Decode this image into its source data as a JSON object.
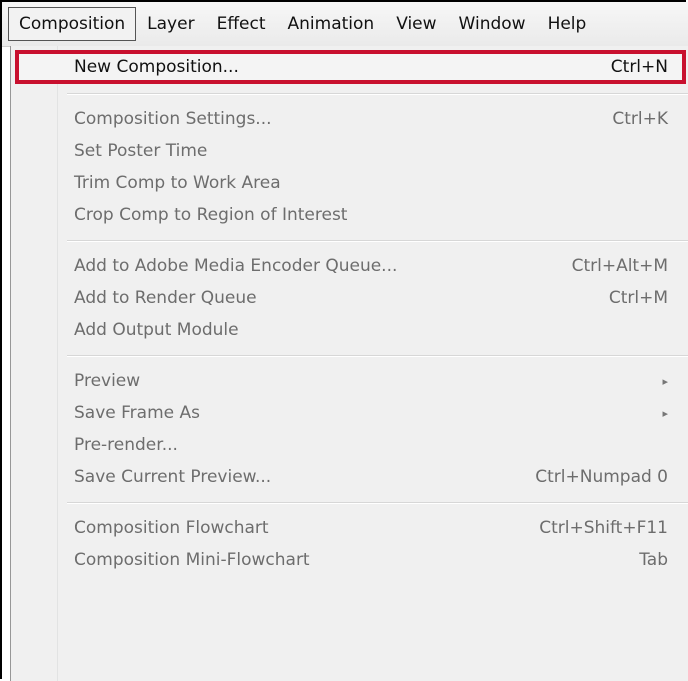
{
  "menubar": {
    "items": [
      {
        "label": "Composition"
      },
      {
        "label": "Layer"
      },
      {
        "label": "Effect"
      },
      {
        "label": "Animation"
      },
      {
        "label": "View"
      },
      {
        "label": "Window"
      },
      {
        "label": "Help"
      }
    ]
  },
  "menu": {
    "new_composition": {
      "label": "New Composition...",
      "shortcut": "Ctrl+N"
    },
    "composition_settings": {
      "label": "Composition Settings...",
      "shortcut": "Ctrl+K"
    },
    "set_poster_time": {
      "label": "Set Poster Time"
    },
    "trim_comp": {
      "label": "Trim Comp to Work Area"
    },
    "crop_comp": {
      "label": "Crop Comp to Region of Interest"
    },
    "add_ame_queue": {
      "label": "Add to Adobe Media Encoder Queue...",
      "shortcut": "Ctrl+Alt+M"
    },
    "add_render_queue": {
      "label": "Add to Render Queue",
      "shortcut": "Ctrl+M"
    },
    "add_output_module": {
      "label": "Add Output Module"
    },
    "preview": {
      "label": "Preview",
      "arrow": "▸"
    },
    "save_frame_as": {
      "label": "Save Frame As",
      "arrow": "▸"
    },
    "pre_render": {
      "label": "Pre-render..."
    },
    "save_current_preview": {
      "label": "Save Current Preview...",
      "shortcut": "Ctrl+Numpad 0"
    },
    "composition_flowchart": {
      "label": "Composition Flowchart",
      "shortcut": "Ctrl+Shift+F11"
    },
    "composition_mini_flowchart": {
      "label": "Composition Mini-Flowchart",
      "shortcut": "Tab"
    }
  }
}
